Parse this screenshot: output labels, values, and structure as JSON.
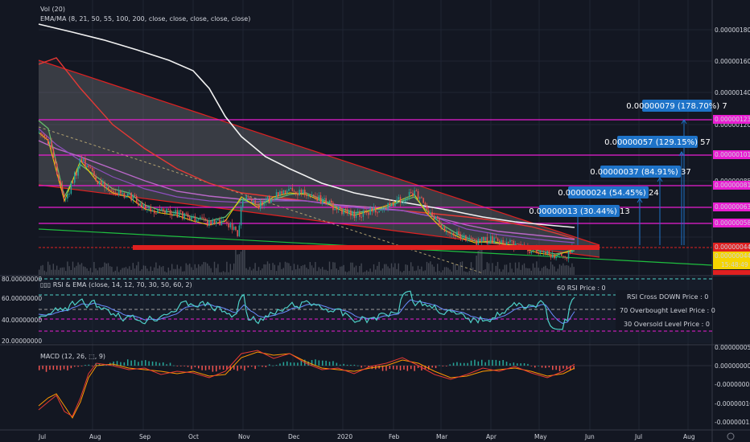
{
  "chart": {
    "indicators": {
      "vol": "Vol (20)",
      "ema": "EMA/MA (8, 21, 50, 55, 100, 200, close, close, close, close, close)",
      "rsi": "▯▯▯ RSI & EMA (close, 14, 12, 70, 30, 50, 60, 2)",
      "macd_prefix": "MACD (12, 26, ",
      "macd_suffix": ", 9)"
    },
    "price_axis": [
      "0.00000180",
      "0.00000160",
      "0.00000140",
      "0.00000120",
      "0.00000085"
    ],
    "price_tags": [
      {
        "text": "0.00000123",
        "color": "#e91ed2"
      },
      {
        "text": "0.00000101",
        "color": "#e91ed2"
      },
      {
        "text": "0.00000081",
        "color": "#e91ed2"
      },
      {
        "text": "0.00000063",
        "color": "#e91ed2"
      },
      {
        "text": "0.00000058",
        "color": "#e91ed2"
      },
      {
        "text": "0.00000044",
        "color": "#e02020"
      },
      {
        "text": "0.00000044",
        "color": "#f5d400"
      },
      {
        "text": "15:48:49",
        "color": "#f5d400"
      }
    ],
    "targets": [
      {
        "text": "0.00000013 (30.44%) 13"
      },
      {
        "text": "0.00000024 (54.45%) 24"
      },
      {
        "text": "0.00000037 (84.91%) 37"
      },
      {
        "text": "0.00000057 (129.15%) 57"
      },
      {
        "text": "0.00000079 (178.70%) 7"
      }
    ],
    "rsi_axis": [
      "80.00000000",
      "60.00000000",
      "40.00000000",
      "20.00000000"
    ],
    "rsi_notes": [
      "60 RSI Price : 0",
      "RSI Cross DOWN Price : 0",
      "70 Overbought Level Price : 0",
      "30 Oversold Level Price : 0"
    ],
    "macd_axis": [
      "0.00000005",
      "0.00000000",
      "-0.00000005",
      "-0.00000010",
      "-0.00000015"
    ],
    "months": [
      "Jul",
      "Aug",
      "Sep",
      "Oct",
      "Nov",
      "Dec",
      "2020",
      "Feb",
      "Mar",
      "Apr",
      "May",
      "Jun",
      "Jul",
      "Aug"
    ],
    "colors": {
      "bg": "#131722",
      "support": "#e02020",
      "level": "#e91ed2",
      "target": "#1e73c8",
      "ema200": "#f2f2f2",
      "ma100": "#e53935",
      "ema55": "#ba68c8",
      "ema8": "#66bb6a",
      "rsi": "#4dd0c8",
      "macd": "#ff9800"
    }
  }
}
